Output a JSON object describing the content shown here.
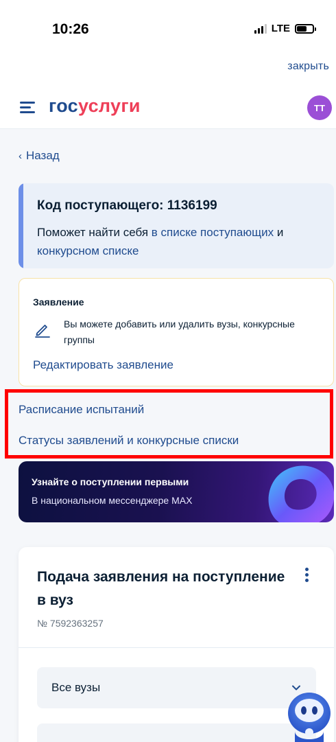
{
  "status_bar": {
    "time": "10:26",
    "network": "LTE",
    "battery_level": 0.65
  },
  "top": {
    "close_label": "закрыть"
  },
  "header": {
    "logo_part1": "гос",
    "logo_part2": "услуги",
    "avatar_initials": "ТТ"
  },
  "nav": {
    "back_label": "Назад"
  },
  "code_card": {
    "title": "Код поступающего: 1136199",
    "text_before": "Поможет найти себя ",
    "link1": "в списке поступающих",
    "text_mid": " и ",
    "link2": "конкурсном списке"
  },
  "application_card": {
    "title": "Заявление",
    "text": "Вы можете добавить или удалить вузы, конкурсные группы",
    "edit_link": "Редактировать заявление"
  },
  "links": {
    "schedule": "Расписание испытаний",
    "statuses": "Статусы заявлений и конкурсные списки"
  },
  "banner": {
    "title": "Узнайте о поступлении первыми",
    "subtitle": "В национальном мессенджере MAX"
  },
  "form_card": {
    "title": "Подача заявления на поступление в вуз",
    "number": "№ 7592363257",
    "select_value": "Все вузы"
  },
  "colors": {
    "accent": "#1f4b8e",
    "logo_red": "#ee3f58",
    "avatar": "#9b4fd6",
    "highlight": "#ff0000"
  }
}
